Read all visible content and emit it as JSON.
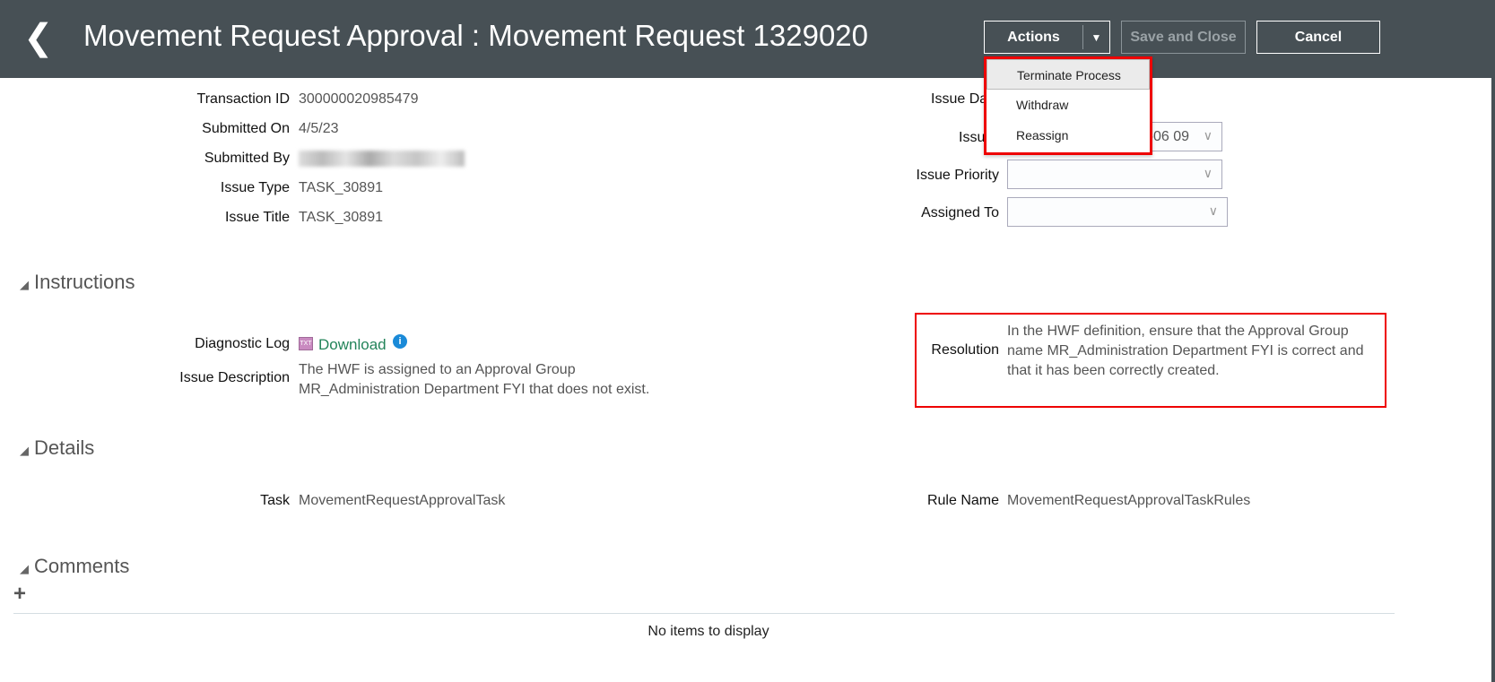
{
  "header": {
    "title": "Movement Request Approval : Movement Request 1329020",
    "actions": "Actions",
    "save_close": "Save and Close",
    "cancel": "Cancel"
  },
  "actions_menu": [
    "Terminate Process",
    "Withdraw",
    "Reassign"
  ],
  "fields_left": [
    {
      "label": "Transaction ID",
      "value": "300000020985479"
    },
    {
      "label": "Submitted On",
      "value": "4/5/23"
    },
    {
      "label": "Submitted By",
      "value": ""
    },
    {
      "label": "Issue Type",
      "value": "TASK_30891"
    },
    {
      "label": "Issue Title",
      "value": "TASK_30891"
    }
  ],
  "fields_right": {
    "issue_date_label": "Issue Da",
    "issue_label": "Issu",
    "issue_value": "-06 09",
    "priority_label": "Issue Priority",
    "assigned_label": "Assigned To"
  },
  "instructions": {
    "title": "Instructions",
    "diag_label": "Diagnostic Log",
    "download": "Download",
    "desc_label": "Issue Description",
    "desc_1": "The HWF is assigned to an Approval Group",
    "desc_2": "MR_Administration Department FYI that does not exist.",
    "res_label": "Resolution",
    "res_1": "In the HWF definition, ensure that the Approval Group",
    "res_2": "name MR_Administration Department FYI is correct and",
    "res_3": "that it has been correctly created."
  },
  "details": {
    "title": "Details",
    "task_label": "Task",
    "task_value": "MovementRequestApprovalTask",
    "rule_label": "Rule Name",
    "rule_value": "MovementRequestApprovalTaskRules"
  },
  "comments": {
    "title": "Comments",
    "empty": "No items to display"
  }
}
